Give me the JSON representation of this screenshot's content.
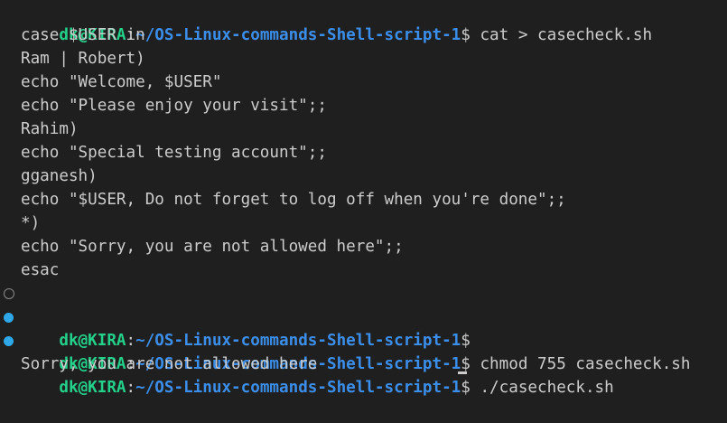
{
  "prompt": {
    "user_host": "dk@KIRA",
    "colon": ":",
    "path": "~/OS-Linux-commands-Shell-script-1",
    "symbol": "$"
  },
  "colors": {
    "background": "#1f1f1f",
    "text": "#cccccc",
    "user_host": "#23d18b",
    "path": "#3b8eea",
    "deco_filled": "#2ea8e8",
    "deco_hollow": "#8a8a8a"
  },
  "lines": [
    {
      "kind": "prompt",
      "command": " cat > casecheck.sh"
    },
    {
      "kind": "output",
      "text": "case $USER in"
    },
    {
      "kind": "output",
      "text": "Ram | Robert)"
    },
    {
      "kind": "output",
      "text": "echo \"Welcome, $USER\""
    },
    {
      "kind": "output",
      "text": "echo \"Please enjoy your visit\";;"
    },
    {
      "kind": "output",
      "text": "Rahim)"
    },
    {
      "kind": "output",
      "text": "echo \"Special testing account\";;"
    },
    {
      "kind": "output",
      "text": "gganesh)"
    },
    {
      "kind": "output",
      "text": "echo \"$USER, Do not forget to log off when you're done\";;"
    },
    {
      "kind": "output",
      "text": "*)"
    },
    {
      "kind": "output",
      "text": "echo \"Sorry, you are not allowed here\";;"
    },
    {
      "kind": "output",
      "text": "esac"
    },
    {
      "kind": "prompt",
      "deco": "hollow",
      "command": ""
    },
    {
      "kind": "prompt",
      "deco": "filled",
      "command": " chmod 755 casecheck.sh"
    },
    {
      "kind": "prompt",
      "deco": "filled",
      "command": " ./casecheck.sh"
    },
    {
      "kind": "output",
      "text": "Sorry, you are not allowed here"
    }
  ],
  "icons": {
    "hollow": "command-status-circle-icon",
    "filled": "command-success-dot-icon"
  }
}
